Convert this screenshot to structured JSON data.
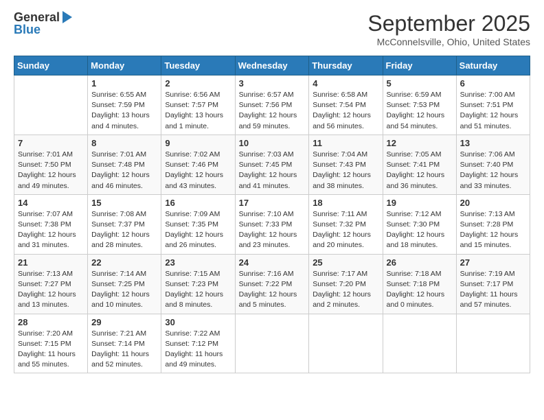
{
  "logo": {
    "general": "General",
    "blue": "Blue"
  },
  "title": "September 2025",
  "location": "McConnelsville, Ohio, United States",
  "weekdays": [
    "Sunday",
    "Monday",
    "Tuesday",
    "Wednesday",
    "Thursday",
    "Friday",
    "Saturday"
  ],
  "weeks": [
    [
      {
        "day": "",
        "info": ""
      },
      {
        "day": "1",
        "info": "Sunrise: 6:55 AM\nSunset: 7:59 PM\nDaylight: 13 hours\nand 4 minutes."
      },
      {
        "day": "2",
        "info": "Sunrise: 6:56 AM\nSunset: 7:57 PM\nDaylight: 13 hours\nand 1 minute."
      },
      {
        "day": "3",
        "info": "Sunrise: 6:57 AM\nSunset: 7:56 PM\nDaylight: 12 hours\nand 59 minutes."
      },
      {
        "day": "4",
        "info": "Sunrise: 6:58 AM\nSunset: 7:54 PM\nDaylight: 12 hours\nand 56 minutes."
      },
      {
        "day": "5",
        "info": "Sunrise: 6:59 AM\nSunset: 7:53 PM\nDaylight: 12 hours\nand 54 minutes."
      },
      {
        "day": "6",
        "info": "Sunrise: 7:00 AM\nSunset: 7:51 PM\nDaylight: 12 hours\nand 51 minutes."
      }
    ],
    [
      {
        "day": "7",
        "info": "Sunrise: 7:01 AM\nSunset: 7:50 PM\nDaylight: 12 hours\nand 49 minutes."
      },
      {
        "day": "8",
        "info": "Sunrise: 7:01 AM\nSunset: 7:48 PM\nDaylight: 12 hours\nand 46 minutes."
      },
      {
        "day": "9",
        "info": "Sunrise: 7:02 AM\nSunset: 7:46 PM\nDaylight: 12 hours\nand 43 minutes."
      },
      {
        "day": "10",
        "info": "Sunrise: 7:03 AM\nSunset: 7:45 PM\nDaylight: 12 hours\nand 41 minutes."
      },
      {
        "day": "11",
        "info": "Sunrise: 7:04 AM\nSunset: 7:43 PM\nDaylight: 12 hours\nand 38 minutes."
      },
      {
        "day": "12",
        "info": "Sunrise: 7:05 AM\nSunset: 7:41 PM\nDaylight: 12 hours\nand 36 minutes."
      },
      {
        "day": "13",
        "info": "Sunrise: 7:06 AM\nSunset: 7:40 PM\nDaylight: 12 hours\nand 33 minutes."
      }
    ],
    [
      {
        "day": "14",
        "info": "Sunrise: 7:07 AM\nSunset: 7:38 PM\nDaylight: 12 hours\nand 31 minutes."
      },
      {
        "day": "15",
        "info": "Sunrise: 7:08 AM\nSunset: 7:37 PM\nDaylight: 12 hours\nand 28 minutes."
      },
      {
        "day": "16",
        "info": "Sunrise: 7:09 AM\nSunset: 7:35 PM\nDaylight: 12 hours\nand 26 minutes."
      },
      {
        "day": "17",
        "info": "Sunrise: 7:10 AM\nSunset: 7:33 PM\nDaylight: 12 hours\nand 23 minutes."
      },
      {
        "day": "18",
        "info": "Sunrise: 7:11 AM\nSunset: 7:32 PM\nDaylight: 12 hours\nand 20 minutes."
      },
      {
        "day": "19",
        "info": "Sunrise: 7:12 AM\nSunset: 7:30 PM\nDaylight: 12 hours\nand 18 minutes."
      },
      {
        "day": "20",
        "info": "Sunrise: 7:13 AM\nSunset: 7:28 PM\nDaylight: 12 hours\nand 15 minutes."
      }
    ],
    [
      {
        "day": "21",
        "info": "Sunrise: 7:13 AM\nSunset: 7:27 PM\nDaylight: 12 hours\nand 13 minutes."
      },
      {
        "day": "22",
        "info": "Sunrise: 7:14 AM\nSunset: 7:25 PM\nDaylight: 12 hours\nand 10 minutes."
      },
      {
        "day": "23",
        "info": "Sunrise: 7:15 AM\nSunset: 7:23 PM\nDaylight: 12 hours\nand 8 minutes."
      },
      {
        "day": "24",
        "info": "Sunrise: 7:16 AM\nSunset: 7:22 PM\nDaylight: 12 hours\nand 5 minutes."
      },
      {
        "day": "25",
        "info": "Sunrise: 7:17 AM\nSunset: 7:20 PM\nDaylight: 12 hours\nand 2 minutes."
      },
      {
        "day": "26",
        "info": "Sunrise: 7:18 AM\nSunset: 7:18 PM\nDaylight: 12 hours\nand 0 minutes."
      },
      {
        "day": "27",
        "info": "Sunrise: 7:19 AM\nSunset: 7:17 PM\nDaylight: 11 hours\nand 57 minutes."
      }
    ],
    [
      {
        "day": "28",
        "info": "Sunrise: 7:20 AM\nSunset: 7:15 PM\nDaylight: 11 hours\nand 55 minutes."
      },
      {
        "day": "29",
        "info": "Sunrise: 7:21 AM\nSunset: 7:14 PM\nDaylight: 11 hours\nand 52 minutes."
      },
      {
        "day": "30",
        "info": "Sunrise: 7:22 AM\nSunset: 7:12 PM\nDaylight: 11 hours\nand 49 minutes."
      },
      {
        "day": "",
        "info": ""
      },
      {
        "day": "",
        "info": ""
      },
      {
        "day": "",
        "info": ""
      },
      {
        "day": "",
        "info": ""
      }
    ]
  ]
}
